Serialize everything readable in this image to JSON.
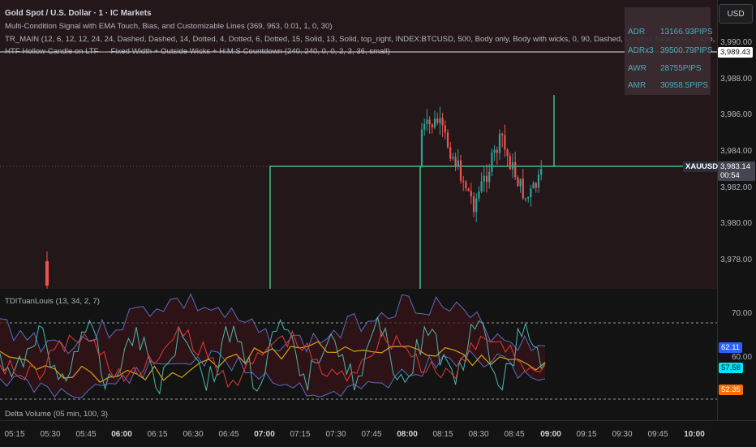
{
  "header": {
    "title": "Gold Spot / U.S. Dollar · 1 · IC Markets",
    "indicator1": "Multi-Condition Signal with EMA Touch, Bias, and Customizable Lines (369, 963, 0.01, 1, 0, 30)",
    "indicator2": "TR_MAIN (12, 6, 12, 12, 24, 24, Dashed, Dashed, 14, Dotted, 4, Dotted, 6, Dotted, 15, Solid, 13, Solid, top_right, INDEX:BTCUSD, 500, Body only, Body with wicks, 0, 90, Dashed, London, New York, Tokyo, HongKong,",
    "indicator3": "HTF Hollow Candle on LTF — Fixed Width + Outside Wicks + H:M:S Countdown (240, 240, 0, 0, 2, 2, 36, small)"
  },
  "currency_button": "USD",
  "adr_table": [
    {
      "label": "ADR",
      "value": "13166.93PIPS"
    },
    {
      "label": "ADRx3",
      "value": "39500.79PIPS"
    },
    {
      "label": "AWR",
      "value": "28755PIPS"
    },
    {
      "label": "AMR",
      "value": "30958.5PIPS"
    }
  ],
  "price_axis": {
    "ticks": [
      "3,990.00",
      "3,988.00",
      "3,986.00",
      "3,984.00",
      "3,982.00",
      "3,980.00",
      "3,978.00"
    ],
    "last_price_line": "3,989.43",
    "current_price": "3,983.14",
    "countdown": "00:54",
    "symbol_label": "XAUUSD"
  },
  "oscillator": {
    "title": "TDITuanLouis (13, 34, 2, 7)",
    "ticks": [
      "70.00",
      "60.00"
    ],
    "labels": [
      {
        "text": "62.11",
        "color": "#2962ff"
      },
      {
        "text": "57.58",
        "color": "#00e5ff"
      },
      {
        "text": "52.35",
        "color": "#ff6d00"
      }
    ]
  },
  "delta_volume": {
    "title": "Delta Volume (05 min, 100, 3)"
  },
  "time_axis": {
    "ticks": [
      {
        "label": "05:15",
        "bold": false
      },
      {
        "label": "05:30",
        "bold": false
      },
      {
        "label": "05:45",
        "bold": false
      },
      {
        "label": "06:00",
        "bold": true
      },
      {
        "label": "06:15",
        "bold": false
      },
      {
        "label": "06:30",
        "bold": false
      },
      {
        "label": "06:45",
        "bold": false
      },
      {
        "label": "07:00",
        "bold": true
      },
      {
        "label": "07:15",
        "bold": false
      },
      {
        "label": "07:30",
        "bold": false
      },
      {
        "label": "07:45",
        "bold": false
      },
      {
        "label": "08:00",
        "bold": true
      },
      {
        "label": "08:15",
        "bold": false
      },
      {
        "label": "08:30",
        "bold": false
      },
      {
        "label": "08:45",
        "bold": false
      },
      {
        "label": "09:00",
        "bold": true
      },
      {
        "label": "09:15",
        "bold": false
      },
      {
        "label": "09:30",
        "bold": false
      },
      {
        "label": "09:45",
        "bold": false
      },
      {
        "label": "10:00",
        "bold": true
      }
    ]
  },
  "colors": {
    "bull": "#26a69a",
    "bear": "#ef5350",
    "level_line": "#3ddc97",
    "adr_text": "#4fb8c8"
  }
}
